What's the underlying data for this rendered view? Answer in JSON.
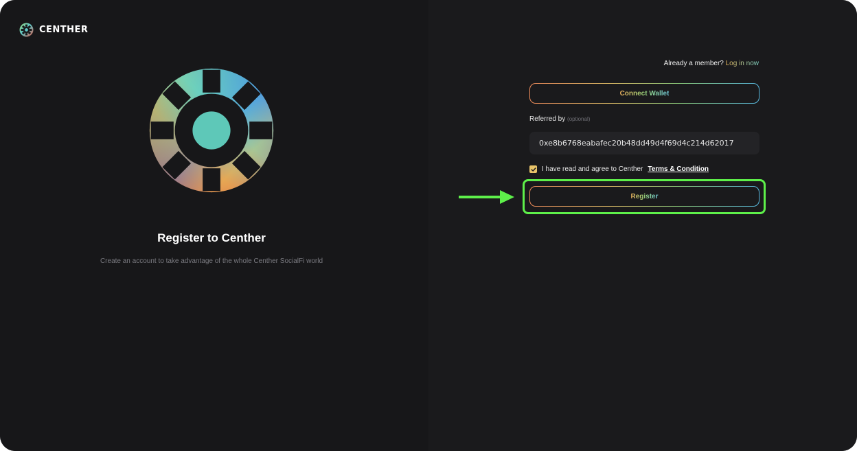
{
  "brand": {
    "name": "CENTHER"
  },
  "hero": {
    "title": "Register to Centher",
    "subtitle": "Create an account to take advantage of the whole Centher SocialFi world"
  },
  "auth": {
    "member_prompt": "Already a member?",
    "login_link": "Log in now"
  },
  "form": {
    "connect_wallet_label": "Connect Wallet",
    "referred_label": "Referred by",
    "referred_optional": "(optional)",
    "referral_value": "0xe8b6768eabafec20b48dd49d4f69d4c214d62017",
    "agree_text": "I have read and agree to Centher",
    "terms_link": "Terms & Condition",
    "agree_checked": true,
    "register_label": "Register"
  },
  "colors": {
    "background": "#1a1a1c",
    "highlight": "#5ef04a",
    "checkbox": "#e9c46a"
  },
  "icons": [
    "centher-logo-icon",
    "check-icon",
    "arrow-right-icon"
  ]
}
